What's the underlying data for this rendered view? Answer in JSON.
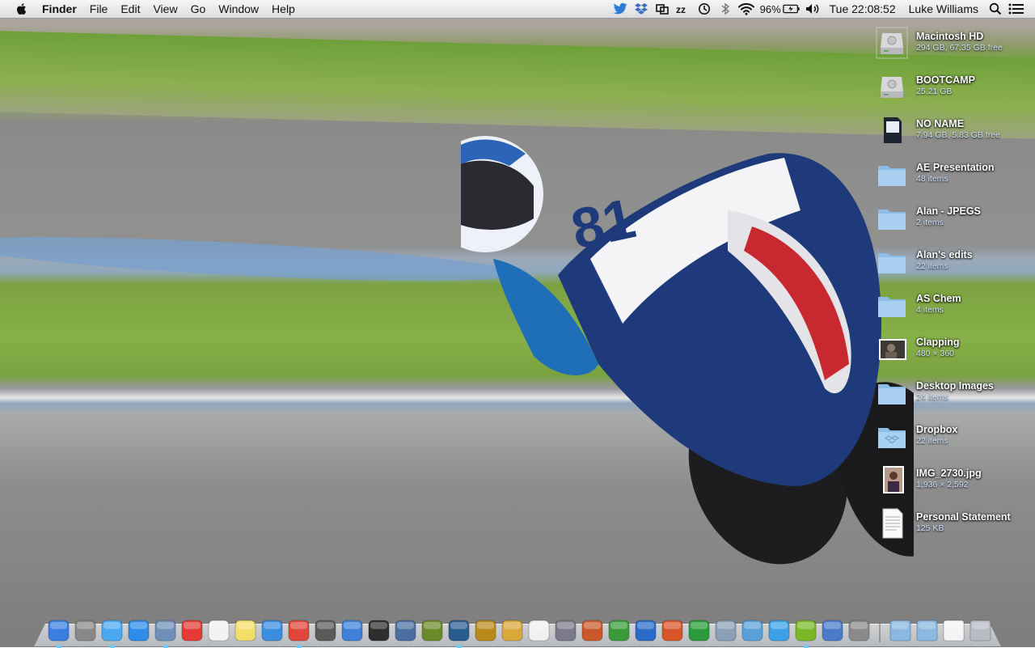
{
  "menubar": {
    "apple_icon": "apple-logo-icon",
    "app_name": "Finder",
    "menus": [
      "File",
      "Edit",
      "View",
      "Go",
      "Window",
      "Help"
    ],
    "status_icons": [
      "twitter-icon",
      "dropbox-icon",
      "screen-mirror-icon",
      "sleep-icon",
      "time-machine-icon",
      "bluetooth-icon",
      "wifi-icon"
    ],
    "battery_percent": "96%",
    "clock": "Tue 22:08:52",
    "user": "Luke Williams",
    "spotlight_icon": "search-icon",
    "notification_icon": "notification-center-icon"
  },
  "desktop": {
    "items": [
      {
        "name": "Macintosh HD",
        "info": "294 GB, 67.35 GB free",
        "icon": "hard-drive-icon"
      },
      {
        "name": "BOOTCAMP",
        "info": "25.21 GB",
        "icon": "hard-drive-icon"
      },
      {
        "name": "NO NAME",
        "info": "7.94 GB, 5.83 GB free",
        "icon": "sd-card-icon"
      },
      {
        "name": "AE Presentation",
        "info": "48 items",
        "icon": "folder-icon"
      },
      {
        "name": "Alan - JPEGS",
        "info": "2 items",
        "icon": "folder-icon"
      },
      {
        "name": "Alan's edits",
        "info": "22 items",
        "icon": "folder-icon"
      },
      {
        "name": "AS Chem",
        "info": "4 items",
        "icon": "folder-icon"
      },
      {
        "name": "Clapping",
        "info": "480 × 360",
        "icon": "video-thumbnail-icon"
      },
      {
        "name": "Desktop Images",
        "info": "24 items",
        "icon": "folder-icon"
      },
      {
        "name": "Dropbox",
        "info": "22 items",
        "icon": "dropbox-folder-icon"
      },
      {
        "name": "IMG_2730.jpg",
        "info": "1,936 × 2,592",
        "icon": "image-thumbnail-icon"
      },
      {
        "name": "Personal Statement",
        "info": "125 KB",
        "icon": "document-icon"
      }
    ]
  },
  "dock": {
    "apps": [
      {
        "icon": "finder-icon",
        "color": "#3a7ee0",
        "running": true
      },
      {
        "icon": "launchpad-icon",
        "color": "#888888",
        "running": false
      },
      {
        "icon": "messages-icon",
        "color": "#4aa8f0",
        "running": true
      },
      {
        "icon": "app-store-icon",
        "color": "#2f8be8",
        "running": false
      },
      {
        "icon": "preview-icon",
        "color": "#6f8fb8",
        "running": true
      },
      {
        "icon": "calendar-icon",
        "color": "#e43b35",
        "running": false
      },
      {
        "icon": "reminders-icon",
        "color": "#f2f2f2",
        "running": false
      },
      {
        "icon": "stickies-icon",
        "color": "#f3de6a",
        "running": false
      },
      {
        "icon": "safari-icon",
        "color": "#3b8de0",
        "running": false
      },
      {
        "icon": "chrome-icon",
        "color": "#e0463a",
        "running": true
      },
      {
        "icon": "imovie-icon",
        "color": "#5a5a5a",
        "running": false
      },
      {
        "icon": "itunes-icon",
        "color": "#3f80d8",
        "running": false
      },
      {
        "icon": "aperture-icon",
        "color": "#2e2e2e",
        "running": false
      },
      {
        "icon": "iphoto-icon",
        "color": "#4a6fa0",
        "running": false
      },
      {
        "icon": "dreamweaver-icon",
        "color": "#6c8a2a",
        "running": false
      },
      {
        "icon": "photoshop-icon",
        "color": "#2a5d8f",
        "running": true
      },
      {
        "icon": "fireworks-icon",
        "color": "#b98a1a",
        "running": false
      },
      {
        "icon": "pineapple-icon",
        "color": "#d8a83a",
        "running": false
      },
      {
        "icon": "textedit-icon",
        "color": "#f0f0f0",
        "running": false
      },
      {
        "icon": "script-editor-icon",
        "color": "#7a7a8a",
        "running": false
      },
      {
        "icon": "keynote-icon",
        "color": "#c85a2a",
        "running": false
      },
      {
        "icon": "numbers-icon",
        "color": "#3a9a3a",
        "running": false
      },
      {
        "icon": "word-icon",
        "color": "#2a6ac8",
        "running": false
      },
      {
        "icon": "powerpoint-icon",
        "color": "#d8552a",
        "running": false
      },
      {
        "icon": "excel-icon",
        "color": "#2a9a3a",
        "running": false
      },
      {
        "icon": "image-capture-icon",
        "color": "#8aa0b8",
        "running": false
      },
      {
        "icon": "archive-icon",
        "color": "#5aa0d8",
        "running": false
      },
      {
        "icon": "twitter-icon",
        "color": "#3aa0e8",
        "running": false
      },
      {
        "icon": "spotify-icon",
        "color": "#7ab82a",
        "running": true
      },
      {
        "icon": "screen-sharing-icon",
        "color": "#4a7ac8",
        "running": false
      },
      {
        "icon": "system-preferences-icon",
        "color": "#8a8a8a",
        "running": false
      }
    ],
    "stacks": [
      {
        "icon": "applications-stack-icon",
        "color": "#8ab8e0"
      },
      {
        "icon": "documents-stack-icon",
        "color": "#8ab8e0"
      },
      {
        "icon": "document-stack-icon",
        "color": "#f4f4f4"
      },
      {
        "icon": "trash-icon",
        "color": "#b8bcc2"
      }
    ]
  }
}
